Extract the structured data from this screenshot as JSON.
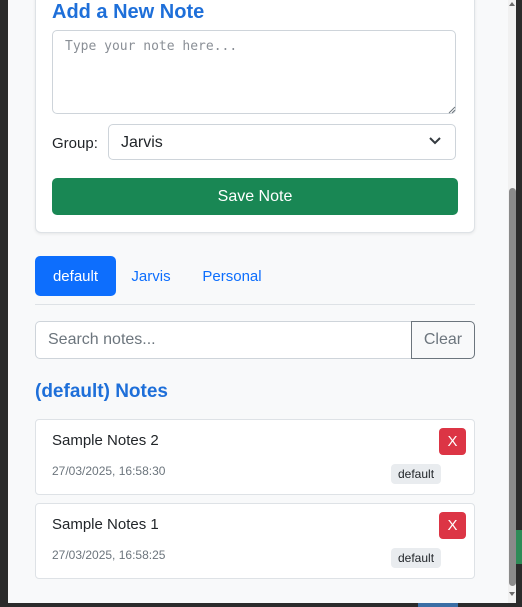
{
  "add_note": {
    "title": "Add a New Note",
    "textarea_placeholder": "Type your note here...",
    "group_label": "Group:",
    "group_selected": "Jarvis",
    "save_label": "Save Note"
  },
  "tabs": [
    {
      "label": "default",
      "active": true
    },
    {
      "label": "Jarvis",
      "active": false
    },
    {
      "label": "Personal",
      "active": false
    }
  ],
  "search": {
    "placeholder": "Search notes...",
    "clear_label": "Clear"
  },
  "notes_heading": "(default) Notes",
  "notes": [
    {
      "text": "Sample Notes 2",
      "timestamp": "27/03/2025, 16:58:30",
      "badge": "default",
      "delete_label": "X"
    },
    {
      "text": "Sample Notes 1",
      "timestamp": "27/03/2025, 16:58:25",
      "badge": "default",
      "delete_label": "X"
    }
  ],
  "colors": {
    "primary": "#0d6efd",
    "success": "#198754",
    "danger": "#dc3545",
    "heading_blue": "#1e6fd9"
  },
  "icons": {
    "select_chevron": "chevron-down-icon",
    "textarea_resize": "resize-grip-icon"
  }
}
